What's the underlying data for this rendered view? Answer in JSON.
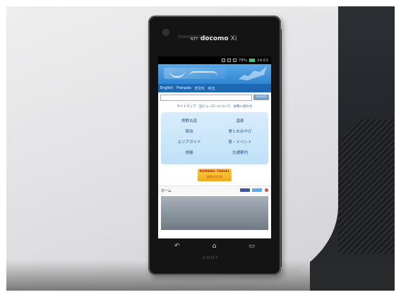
{
  "phone": {
    "brand": "docomo",
    "brand_prefix": "NTT",
    "brand_suffix": "Xi",
    "maker": "SONY"
  },
  "statusbar": {
    "battery": "78%",
    "time": "14:03"
  },
  "screen": {
    "language_links": [
      "English",
      "Français",
      "한국어",
      "中文"
    ],
    "search_button": "Search",
    "sub_links": [
      "サイトマップ",
      "当ビューローについて",
      "お問い合わせ"
    ],
    "menu_items": [
      "熊野古道",
      "温泉",
      "宿泊",
      "食とおみやげ",
      "エリアガイド",
      "祭・イベント",
      "体験",
      "交通案内"
    ],
    "kumano": {
      "title": "KUMANO TRAVEL",
      "subtitle": "熊野の旅予約"
    },
    "home_label": "ホーム"
  },
  "nav": {
    "back_icon": "back-icon",
    "home_icon": "home-icon",
    "recent_icon": "recent-apps-icon"
  }
}
